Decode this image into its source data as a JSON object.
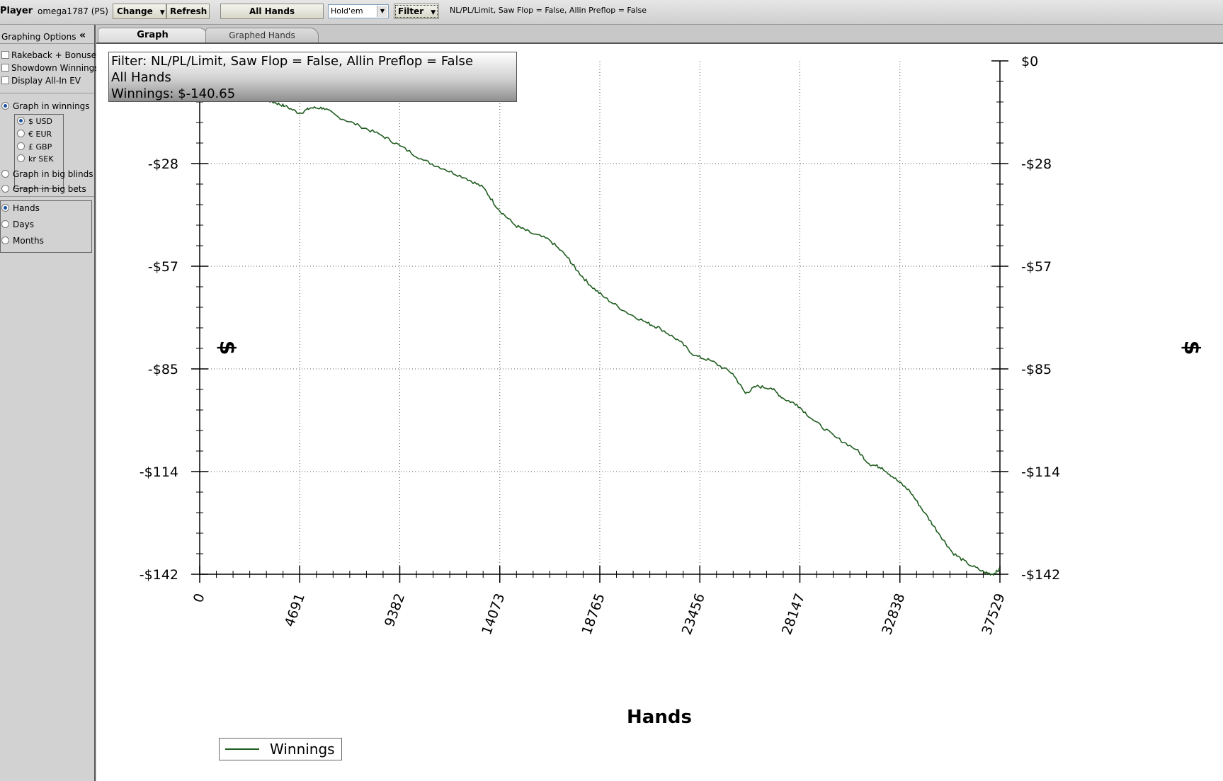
{
  "toolbar": {
    "player_label": "Player",
    "player_name": "omega1787 (PS)",
    "change_label": "Change",
    "refresh_label": "Refresh",
    "all_hands_label": "All Hands",
    "game_select_value": "Hold'em",
    "filter_label": "Filter",
    "filter_summary": "NL/PL/Limit, Saw Flop = False, Allin Preflop = False"
  },
  "sidebar": {
    "header_title": "Graphing Options",
    "collapse_icon": "double-chevron-left-icon",
    "checkboxes": [
      {
        "label": "Rakeback + Bonuses",
        "checked": false
      },
      {
        "label": "Showdown Winnings",
        "checked": false
      },
      {
        "label": "Display All-In EV",
        "checked": false
      }
    ],
    "graph_modes": [
      {
        "label": "Graph in winnings",
        "selected": true
      },
      {
        "label": "Graph in big blinds",
        "selected": false
      },
      {
        "label": "Graph in big bets",
        "selected": false
      }
    ],
    "currencies": [
      {
        "label": "$ USD",
        "selected": true
      },
      {
        "label": "€ EUR",
        "selected": false
      },
      {
        "label": "£ GBP",
        "selected": false
      },
      {
        "label": "kr SEK",
        "selected": false
      }
    ],
    "x_axis_modes": [
      {
        "label": "Hands",
        "selected": true
      },
      {
        "label": "Days",
        "selected": false
      },
      {
        "label": "Months",
        "selected": false
      }
    ]
  },
  "tabs": [
    {
      "label": "Graph",
      "active": true
    },
    {
      "label": "Graphed Hands",
      "active": false
    }
  ],
  "info_box": {
    "line1": "Filter: NL/PL/Limit, Saw Flop = False, Allin Preflop = False",
    "line2": "All Hands",
    "line3": "Winnings: $-140.65"
  },
  "chart_data": {
    "type": "line",
    "xlabel": "Hands",
    "ylabel": "$",
    "xlim": [
      0,
      37529
    ],
    "ylim": [
      -142,
      0
    ],
    "x_ticks": [
      "0",
      "4691",
      "9382",
      "14073",
      "18765",
      "23456",
      "28147",
      "32838",
      "37529"
    ],
    "y_ticks": [
      "$0",
      "-$28",
      "-$57",
      "-$85",
      "-$114",
      "-$142"
    ],
    "grid": true,
    "legend_position": "bottom-left",
    "series": [
      {
        "name": "Winnings",
        "color": "#1f5c1f",
        "points": [
          [
            0,
            0
          ],
          [
            1000,
            -4
          ],
          [
            2000,
            -7
          ],
          [
            3000,
            -10.5
          ],
          [
            3500,
            -11.5
          ],
          [
            4000,
            -12.5
          ],
          [
            4700,
            -14.5
          ],
          [
            5200,
            -13
          ],
          [
            5800,
            -13
          ],
          [
            6500,
            -15.5
          ],
          [
            7500,
            -18
          ],
          [
            8500,
            -20.5
          ],
          [
            9400,
            -23.5
          ],
          [
            10500,
            -27.5
          ],
          [
            11500,
            -30
          ],
          [
            12500,
            -32.5
          ],
          [
            13300,
            -35
          ],
          [
            14000,
            -41
          ],
          [
            14800,
            -45.5
          ],
          [
            15500,
            -47.5
          ],
          [
            16400,
            -49.5
          ],
          [
            17200,
            -54
          ],
          [
            17700,
            -58
          ],
          [
            18300,
            -62
          ],
          [
            19000,
            -65.5
          ],
          [
            20000,
            -69.5
          ],
          [
            21000,
            -72.5
          ],
          [
            21600,
            -74
          ],
          [
            22500,
            -77.5
          ],
          [
            23200,
            -81.5
          ],
          [
            24000,
            -83
          ],
          [
            25000,
            -86.5
          ],
          [
            25600,
            -92
          ],
          [
            26100,
            -90
          ],
          [
            26800,
            -90.5
          ],
          [
            27400,
            -93.5
          ],
          [
            28000,
            -95
          ],
          [
            28800,
            -99.5
          ],
          [
            29800,
            -104
          ],
          [
            30800,
            -107.5
          ],
          [
            31400,
            -111.5
          ],
          [
            32000,
            -112.5
          ],
          [
            32700,
            -116
          ],
          [
            33300,
            -119
          ],
          [
            34000,
            -125
          ],
          [
            34700,
            -131
          ],
          [
            35300,
            -136
          ],
          [
            36000,
            -139
          ],
          [
            36800,
            -141.5
          ],
          [
            37200,
            -142
          ],
          [
            37529,
            -140.65
          ]
        ]
      }
    ]
  }
}
